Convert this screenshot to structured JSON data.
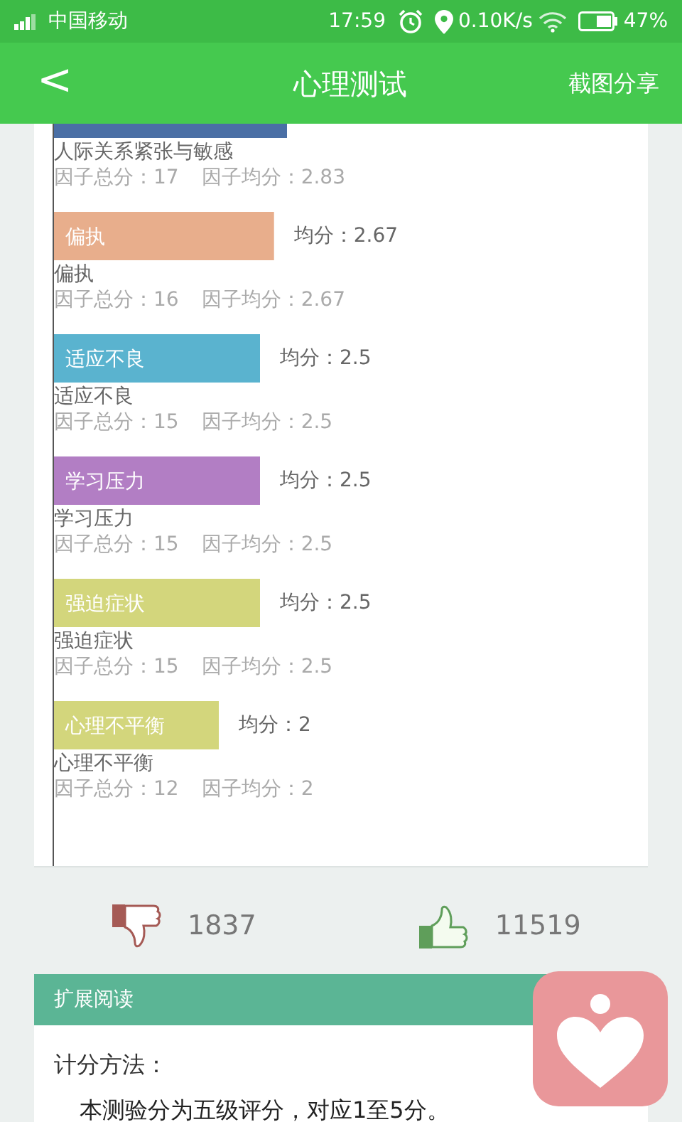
{
  "status_bar": {
    "carrier": "中国移动",
    "time": "17:59",
    "speed": "0.10K/s",
    "battery": "47%"
  },
  "header": {
    "back": "<",
    "title": "心理测试",
    "action": "截图分享"
  },
  "factors": [
    {
      "name": "人际关系紧张与敏感",
      "total": "因子总分：17",
      "average": "因子均分：2.83",
      "color": "#4a6fa5"
    },
    {
      "name": "偏执",
      "total": "因子总分：16",
      "average": "因子均分：2.67",
      "color": "#e8ae8c"
    },
    {
      "name": "适应不良",
      "total": "因子总分：15",
      "average": "因子均分：2.5",
      "color": "#5ab3cf"
    },
    {
      "name": "学习压力",
      "total": "因子总分：15",
      "average": "因子均分：2.5",
      "color": "#b27ec4"
    },
    {
      "name": "强迫症状",
      "total": "因子总分：15",
      "average": "因子均分：2.5",
      "color": "#d3d67c"
    },
    {
      "name": "心理不平衡",
      "total": "因子总分：12",
      "average": "因子均分：2",
      "color": "#d3d67c"
    }
  ],
  "chart_data": {
    "type": "bar",
    "orientation": "horizontal",
    "categories": [
      null,
      "偏执",
      "适应不良",
      "学习压力",
      "强迫症状",
      "心理不平衡"
    ],
    "values": [
      2.83,
      2.67,
      2.5,
      2.5,
      2.5,
      2
    ],
    "value_labels": [
      null,
      "均分：2.67",
      "均分：2.5",
      "均分：2.5",
      "均分：2.5",
      "均分：2"
    ]
  },
  "votes": {
    "dislikes": "1837",
    "likes": "11519"
  },
  "reading": {
    "title": "扩展阅读",
    "heading": "计分方法：",
    "text": "本测验分为五级评分，对应1至5分。"
  }
}
